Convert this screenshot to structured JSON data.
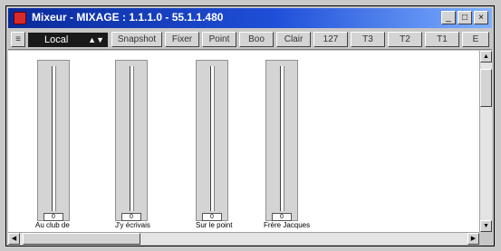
{
  "window": {
    "title": "Mixeur - MIXAGE : 1.1.1.0 - 55.1.1.480",
    "buttons": {
      "minimize": "_",
      "maximize": "□",
      "close": "×"
    }
  },
  "toolbar": {
    "menu_icon": "≡",
    "select_value": "Local",
    "buttons": [
      "Snapshot",
      "Fixer",
      "Point",
      "Boo",
      "Clair",
      "127",
      "T3",
      "T2",
      "T1",
      "E"
    ]
  },
  "faders": [
    {
      "label": "Au club de",
      "knob": "0"
    },
    {
      "label": "J'y écrivais",
      "knob": "0"
    },
    {
      "label": "Sur le point",
      "knob": "0"
    },
    {
      "label": "Frère Jacques",
      "knob": "0"
    }
  ],
  "scrollbars": {
    "up": "▲",
    "down": "▼",
    "left": "◀",
    "right": "▶"
  }
}
